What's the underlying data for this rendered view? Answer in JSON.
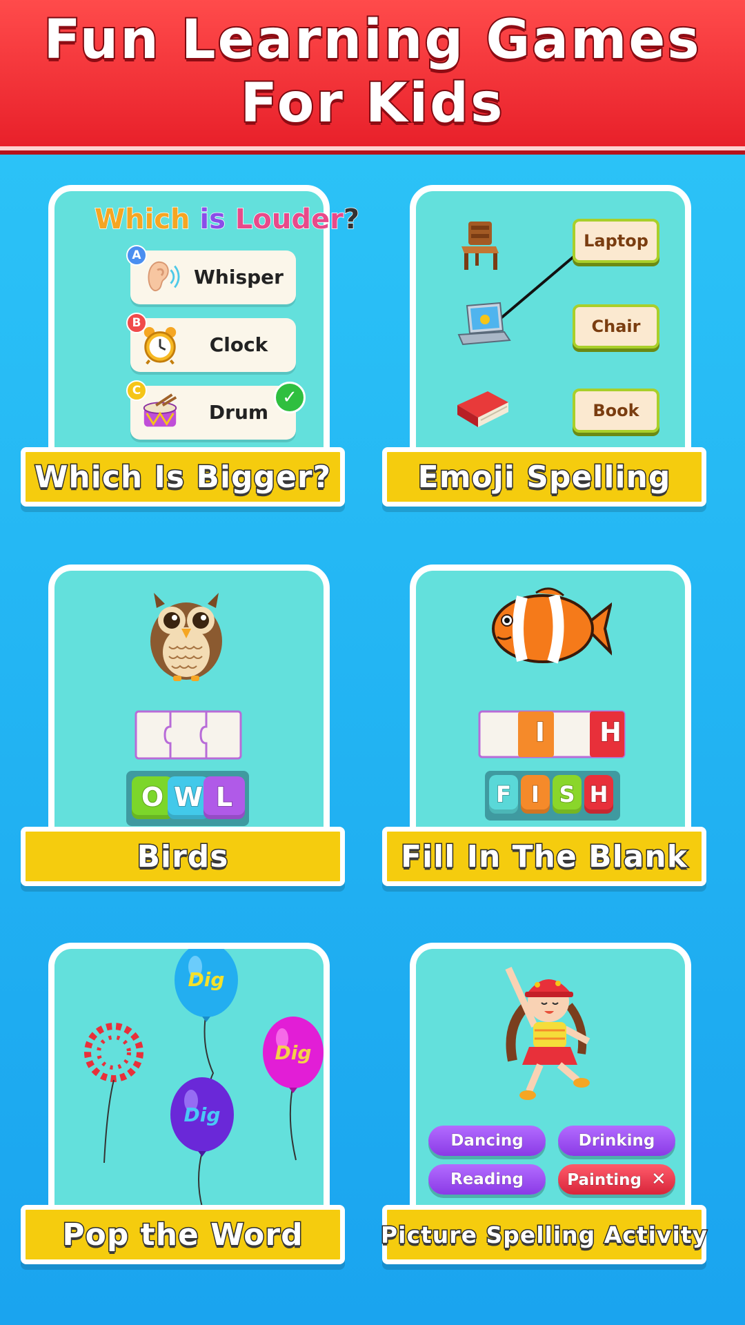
{
  "header": {
    "title_line1": "Fun Learning Games",
    "title_line2": "For Kids"
  },
  "cards": [
    {
      "label": "Which Is Bigger?",
      "quiz": {
        "question_parts": [
          {
            "text": "Which",
            "color": "#f5a623"
          },
          {
            "text": " is ",
            "color": "#8a4ee8"
          },
          {
            "text": "Louder",
            "color": "#e84a8a"
          },
          {
            "text": "?",
            "color": "#333333"
          }
        ],
        "options": [
          {
            "letter": "A",
            "text": "Whisper",
            "icon": "ear-icon"
          },
          {
            "letter": "B",
            "text": "Clock",
            "icon": "alarm-clock-icon"
          },
          {
            "letter": "C",
            "text": "Drum",
            "icon": "drum-icon",
            "correct": true
          }
        ]
      }
    },
    {
      "label": "Emoji Spelling",
      "match": {
        "pictures": [
          "chair-icon",
          "laptop-icon",
          "book-icon"
        ],
        "words": [
          "Laptop",
          "Chair",
          "Book"
        ]
      }
    },
    {
      "label": "Birds",
      "letters": [
        "O",
        "W",
        "L"
      ],
      "picture": "owl-icon"
    },
    {
      "label": "Fill In The Blank",
      "blank_letters": [
        "I",
        "H"
      ],
      "letters": [
        "F",
        "I",
        "S",
        "H"
      ],
      "picture": "clownfish-icon"
    },
    {
      "label": "Pop the Word",
      "balloons": [
        "Dig",
        "Dig",
        "Dig"
      ]
    },
    {
      "label": "Picture Spelling Activity",
      "choices": [
        "Dancing",
        "Drinking",
        "Reading",
        "Painting"
      ],
      "picture": "dancing-girl-icon"
    }
  ],
  "colors": {
    "background": "#23b5f3",
    "header": "#e8202a",
    "panel": "#63e0dc",
    "label_bar": "#f5cc0e"
  }
}
